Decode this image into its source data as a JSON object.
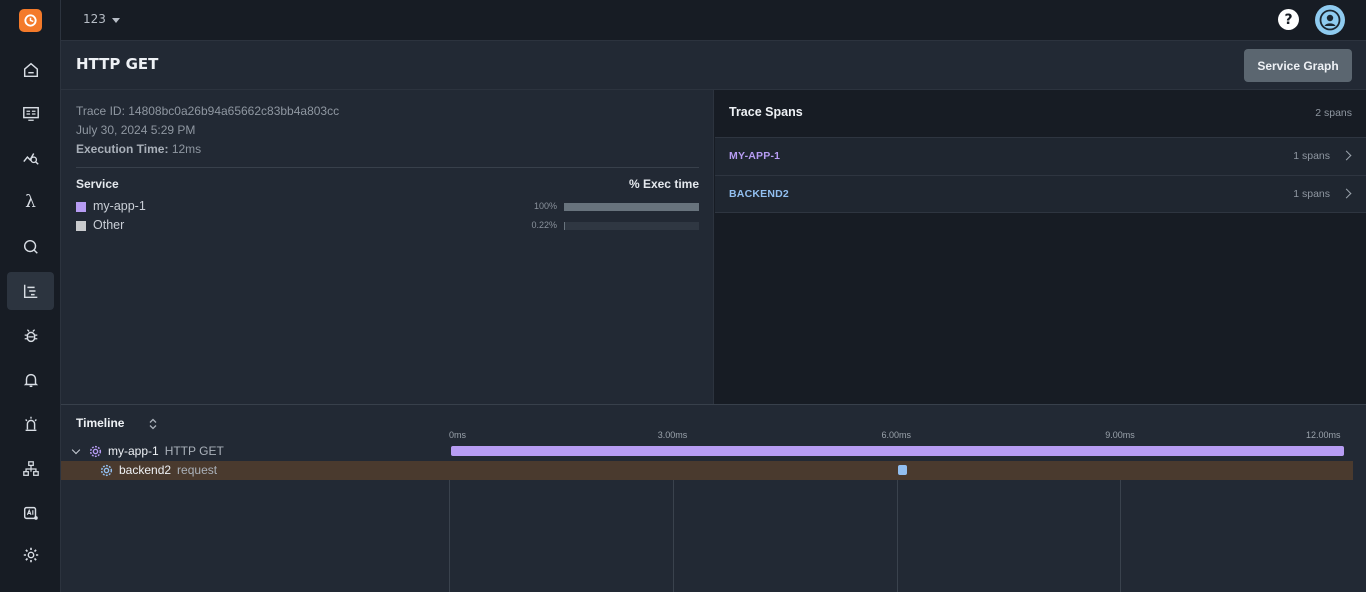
{
  "topbar": {
    "org_name": "123",
    "help_label": "?"
  },
  "header": {
    "title": "HTTP GET",
    "service_graph_label": "Service Graph"
  },
  "trace": {
    "id_text": "Trace ID: 14808bc0a26b94a65662c83bb4a803cc",
    "date": "July 30, 2024 5:29 PM",
    "exec_label": "Execution Time:",
    "exec_value": "12ms"
  },
  "services": {
    "col_service": "Service",
    "col_exec": "% Exec time",
    "rows": [
      {
        "name": "my-app-1",
        "pct_label": "100%",
        "fraction": 1.0,
        "color": "#b79cf3",
        "bar_color": "#68737d"
      },
      {
        "name": "Other",
        "pct_label": "0.22%",
        "fraction": 0.0022,
        "color": "#c9cbce",
        "bar_color": "#68737d"
      }
    ]
  },
  "spans": {
    "title": "Trace Spans",
    "count": "2 spans",
    "items": [
      {
        "name": "MY-APP-1",
        "count": "1 spans",
        "color": "#b79cf3"
      },
      {
        "name": "BACKEND2",
        "count": "1 spans",
        "color": "#92bff0"
      }
    ]
  },
  "timeline": {
    "title": "Timeline",
    "ticks": [
      "0ms",
      "3.00ms",
      "6.00ms",
      "9.00ms",
      "12.00ms"
    ],
    "max_ms": 12,
    "rows": [
      {
        "service": "my-app-1",
        "operation": "HTTP GET",
        "start_ms": 0,
        "duration_ms": 12,
        "color": "#b79cf3"
      },
      {
        "service": "backend2",
        "operation": "request",
        "start_ms": 6.0,
        "duration_ms": 0.1,
        "color": "#92bff0"
      }
    ]
  },
  "colors": {
    "accent": "#f47a2a",
    "selected_row": "#4a3a2e"
  }
}
